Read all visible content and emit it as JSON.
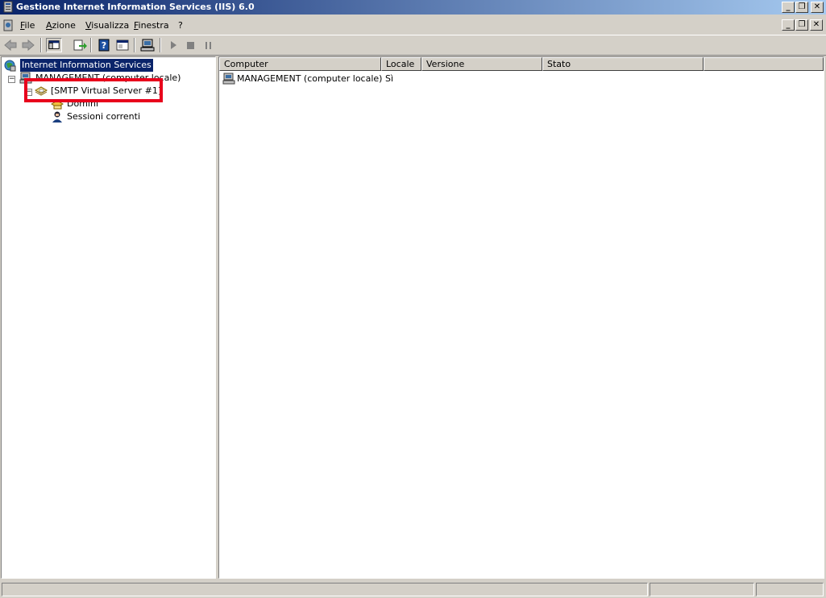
{
  "window": {
    "title": "Gestione Internet Information Services (IIS) 6.0"
  },
  "menu": {
    "items": [
      "File",
      "Azione",
      "Visualizza",
      "Finestra",
      "?"
    ]
  },
  "toolbar": {
    "buttons": [
      "back-icon",
      "forward-icon",
      "show-hide-console-tree-icon",
      "export-list-icon",
      "help-icon",
      "properties-icon",
      "computer-icon",
      "play-icon",
      "stop-icon",
      "pause-icon"
    ]
  },
  "tree": {
    "root": "Internet Information Services",
    "computer": "MANAGEMENT (computer locale)",
    "server": "[SMTP Virtual Server #1]",
    "domains": "Domini",
    "sessions": "Sessioni correnti",
    "expander_symbol": "−"
  },
  "list": {
    "columns": [
      "Computer",
      "Locale",
      "Versione",
      "Stato"
    ],
    "rows": [
      {
        "computer": "MANAGEMENT (computer locale)",
        "locale": "Sì",
        "versione": "",
        "stato": ""
      }
    ]
  },
  "caption_buttons": {
    "minimize": "_",
    "restore": "❐",
    "close": "✕"
  },
  "colors": {
    "highlight_box": "#e8001c",
    "selection": "#0a246a",
    "titlebar": "#0a246a"
  }
}
